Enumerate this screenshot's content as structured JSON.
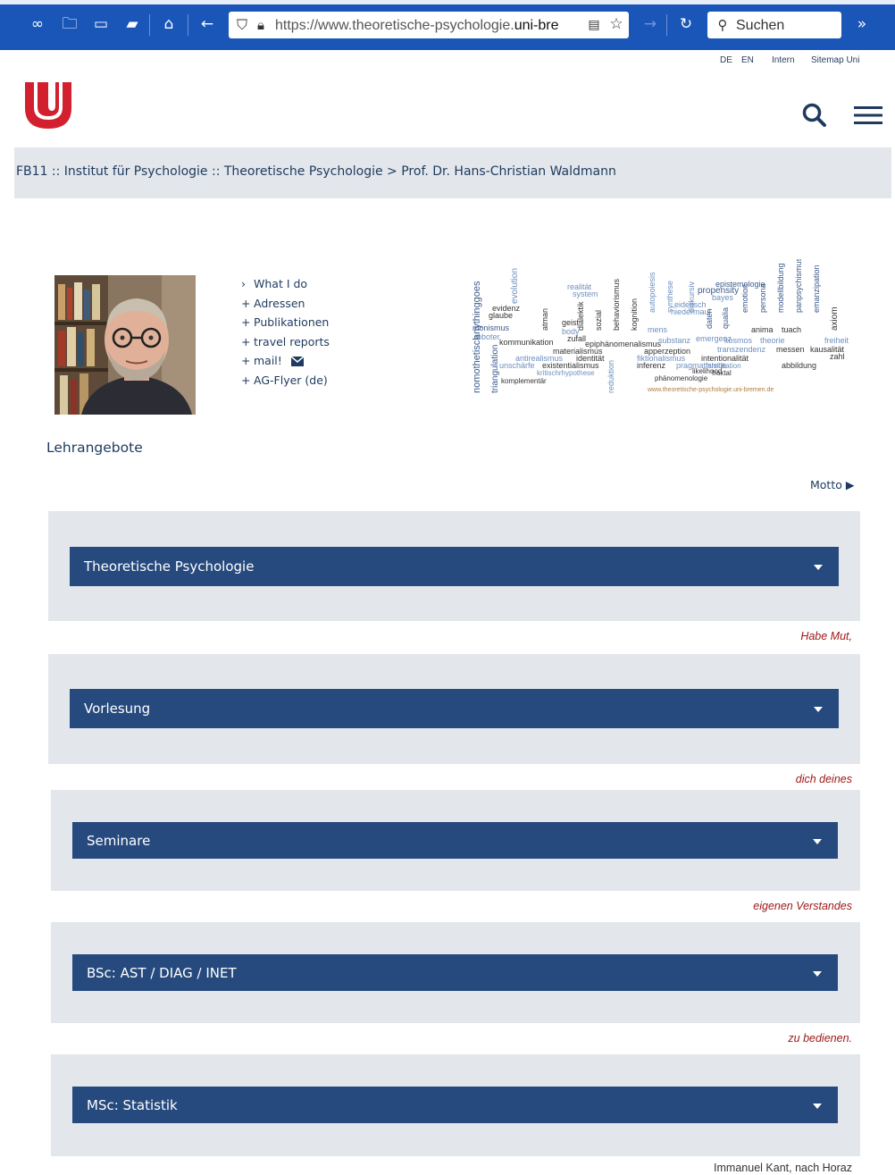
{
  "browser": {
    "url_prefix": "https://www.theoretische-psychologie.",
    "url_domain": "uni-bre",
    "search_placeholder": "Suchen",
    "icons": [
      "infinity-icon",
      "folder-icon",
      "sidebar-icon",
      "screenshot-icon",
      "home-icon",
      "back-icon",
      "forward-icon",
      "reload-icon",
      "overflow-icon"
    ]
  },
  "meta_links": {
    "de": "DE",
    "en": "EN",
    "intern": "Intern",
    "sitemap": "Sitemap Uni"
  },
  "breadcrumb": {
    "text": "FB11 :: Institut für Psychologie :: Theoretische Psychologie > Prof. Dr. Hans-Christian Waldmann"
  },
  "links": [
    {
      "marker": "›",
      "label": "What I do"
    },
    {
      "marker": "+",
      "label": "Adressen"
    },
    {
      "marker": "+",
      "label": "Publikationen"
    },
    {
      "marker": "+",
      "label": "travel reports"
    },
    {
      "marker": "+",
      "label": "mail!"
    },
    {
      "marker": "+",
      "label": "AG-Flyer (de)"
    }
  ],
  "wordcloud": {
    "credit": "www.theoretische-psychologie.uni-bremen.de"
  },
  "heading": "Lehrangebote",
  "motto_label": "Motto",
  "sections": [
    {
      "label": "Theoretische Psychologie"
    },
    {
      "label": "Vorlesung"
    },
    {
      "label": "Seminare"
    },
    {
      "label": "BSc: AST / DIAG / INET"
    },
    {
      "label": "MSc: Statistik"
    }
  ],
  "quote": {
    "lines": [
      "Habe Mut,",
      "dich deines",
      "eigenen Verstandes",
      "zu bedienen."
    ],
    "author": "Immanuel Kant, nach Horaz"
  },
  "colors": {
    "accent_red": "#d2202f",
    "bar_blue": "#264a7e",
    "section_bg": "#e3e7ec",
    "quote_red": "#a01818"
  }
}
